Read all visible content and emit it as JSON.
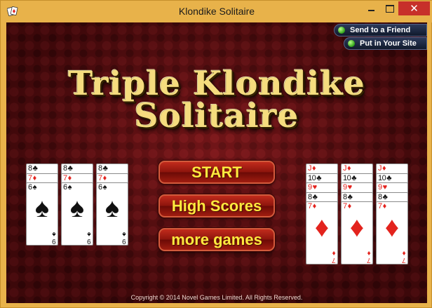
{
  "window": {
    "title": "Klondike Solitaire",
    "close_glyph": "✕",
    "app_icon": "solitaire-cards-icon"
  },
  "share": {
    "friend_label": "Send to a Friend",
    "site_label": "Put in Your Site"
  },
  "logo": {
    "line1": "Triple Klondike",
    "line2": "Solitaire"
  },
  "menu": {
    "start_label": "START",
    "scores_label": "High Scores",
    "more_label": "more games"
  },
  "cards": {
    "left_piles": [
      [
        {
          "rank": "8",
          "suit": "♣",
          "color": "black"
        },
        {
          "rank": "7",
          "suit": "♦",
          "color": "red"
        },
        {
          "rank": "6",
          "suit": "♠",
          "color": "black"
        }
      ],
      [
        {
          "rank": "8",
          "suit": "♣",
          "color": "black"
        },
        {
          "rank": "7",
          "suit": "♦",
          "color": "red"
        },
        {
          "rank": "6",
          "suit": "♠",
          "color": "black"
        }
      ],
      [
        {
          "rank": "8",
          "suit": "♣",
          "color": "black"
        },
        {
          "rank": "7",
          "suit": "♦",
          "color": "red"
        },
        {
          "rank": "6",
          "suit": "♠",
          "color": "black"
        }
      ]
    ],
    "left_corner": "9",
    "right_piles": [
      [
        {
          "rank": "J",
          "suit": "♦",
          "color": "red"
        },
        {
          "rank": "10",
          "suit": "♣",
          "color": "black"
        },
        {
          "rank": "9",
          "suit": "♥",
          "color": "red"
        },
        {
          "rank": "8",
          "suit": "♣",
          "color": "black"
        },
        {
          "rank": "7",
          "suit": "♦",
          "color": "red"
        }
      ],
      [
        {
          "rank": "J",
          "suit": "♦",
          "color": "red"
        },
        {
          "rank": "10",
          "suit": "♣",
          "color": "black"
        },
        {
          "rank": "9",
          "suit": "♥",
          "color": "red"
        },
        {
          "rank": "8",
          "suit": "♣",
          "color": "black"
        },
        {
          "rank": "7",
          "suit": "♦",
          "color": "red"
        }
      ],
      [
        {
          "rank": "J",
          "suit": "♦",
          "color": "red"
        },
        {
          "rank": "10",
          "suit": "♣",
          "color": "black"
        },
        {
          "rank": "9",
          "suit": "♥",
          "color": "red"
        },
        {
          "rank": "8",
          "suit": "♣",
          "color": "black"
        },
        {
          "rank": "7",
          "suit": "♦",
          "color": "red"
        }
      ]
    ],
    "right_corner": "7"
  },
  "copyright": "Copyright © 2014 Novel Games Limited. All Rights Reserved.",
  "colors": {
    "title_bar": "#e8b24a",
    "close_button": "#c7302a",
    "table_background": "#5e0e12",
    "menu_text": "#ffe93e",
    "logo_text": "#f5dc7e",
    "red_suit": "#e3231d"
  }
}
